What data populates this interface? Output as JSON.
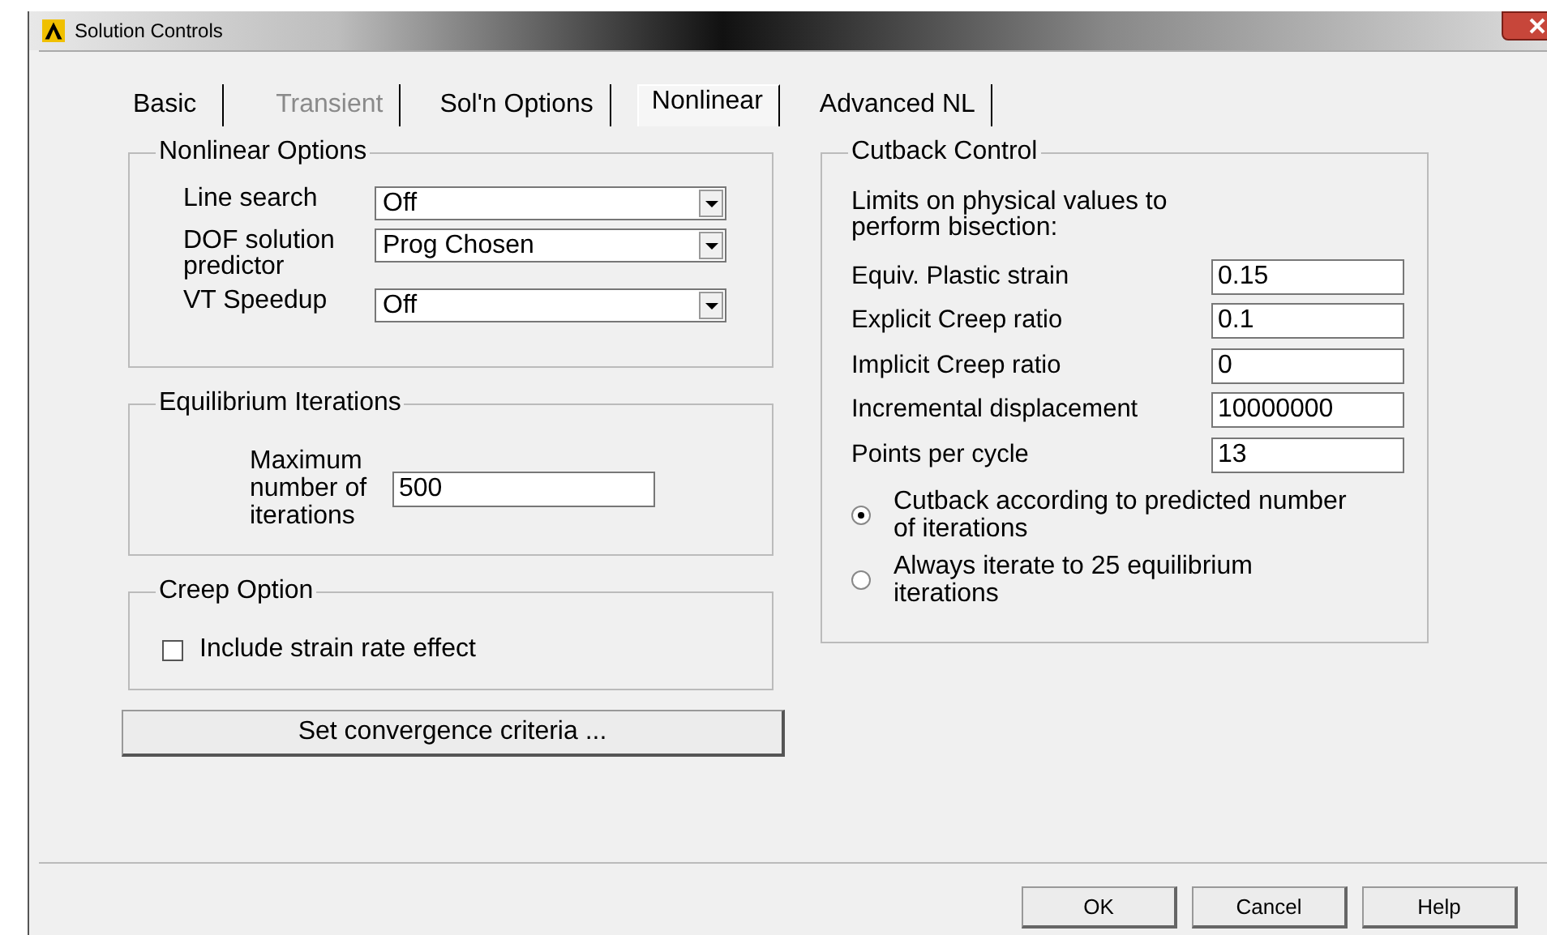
{
  "window": {
    "title": "Solution Controls"
  },
  "tabs": [
    {
      "label": "Basic",
      "selected": false,
      "disabled": false
    },
    {
      "label": "Transient",
      "selected": false,
      "disabled": true
    },
    {
      "label": "Sol'n Options",
      "selected": false,
      "disabled": false
    },
    {
      "label": "Nonlinear",
      "selected": true,
      "disabled": false
    },
    {
      "label": "Advanced NL",
      "selected": false,
      "disabled": false
    }
  ],
  "nonlinear_options": {
    "title": "Nonlinear Options",
    "rows": [
      {
        "label": "Line search",
        "value": "Off"
      },
      {
        "label": "DOF solution predictor",
        "value": "Prog Chosen"
      },
      {
        "label": "VT Speedup",
        "value": "Off"
      }
    ]
  },
  "equilibrium_iterations": {
    "title": "Equilibrium Iterations",
    "label": "Maximum number of iterations",
    "value": "500"
  },
  "creep_option": {
    "title": "Creep Option",
    "checkbox": {
      "label": "Include strain rate effect",
      "checked": false
    }
  },
  "convergence_button": "Set convergence criteria ...",
  "cutback_control": {
    "title": "Cutback Control",
    "intro": "Limits on physical values to perform bisection:",
    "fields": [
      {
        "label": "Equiv. Plastic strain",
        "value": "0.15"
      },
      {
        "label": "Explicit Creep ratio",
        "value": "0.1"
      },
      {
        "label": "Implicit Creep ratio",
        "value": "0"
      },
      {
        "label": "Incremental displacement",
        "value": "10000000"
      },
      {
        "label": "Points per cycle",
        "value": "13"
      }
    ],
    "options": [
      {
        "label": "Cutback according to predicted number of iterations",
        "selected": true
      },
      {
        "label": "Always iterate to 25 equilibrium iterations",
        "selected": false
      }
    ]
  },
  "buttons": [
    "OK",
    "Cancel",
    "Help"
  ]
}
